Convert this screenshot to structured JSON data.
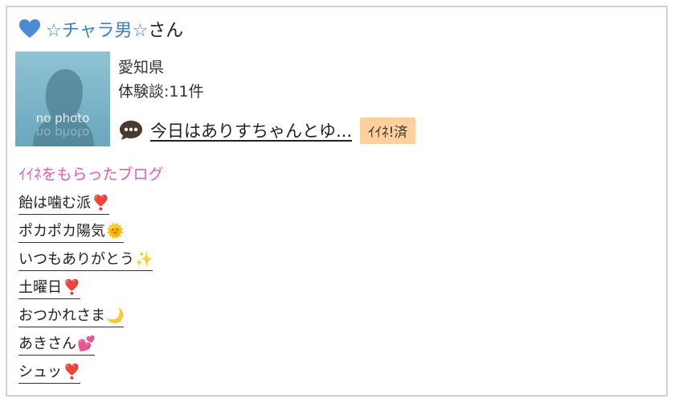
{
  "user": {
    "name": "☆チャラ男☆",
    "suffix": "さん",
    "location": "愛知県",
    "review_count": "体験談:11件",
    "latest_review": "今日はありすちゃんとゆ...",
    "iine_badge": "ｲｲﾈ!済",
    "avatar_text": "no photo"
  },
  "blog_section": {
    "title": "ｲｲﾈをもらったブログ",
    "items": [
      {
        "label": "飴は噛む派",
        "emoji": "❣️"
      },
      {
        "label": "ポカポカ陽気",
        "emoji": "🌞"
      },
      {
        "label": "いつもありがとう",
        "emoji": "✨"
      },
      {
        "label": "土曜日",
        "emoji": "❣️"
      },
      {
        "label": "おつかれさま",
        "emoji": "🌙"
      },
      {
        "label": "あきさん",
        "emoji": "💕"
      },
      {
        "label": "シュッ",
        "emoji": "❣️"
      }
    ]
  },
  "colors": {
    "heart": "#4b8ad6",
    "user_link": "#3a7fc8",
    "section_title": "#ea59b1",
    "badge": "#ffd09b"
  },
  "icons": [
    "heart-icon",
    "chat-bubble-icon"
  ]
}
